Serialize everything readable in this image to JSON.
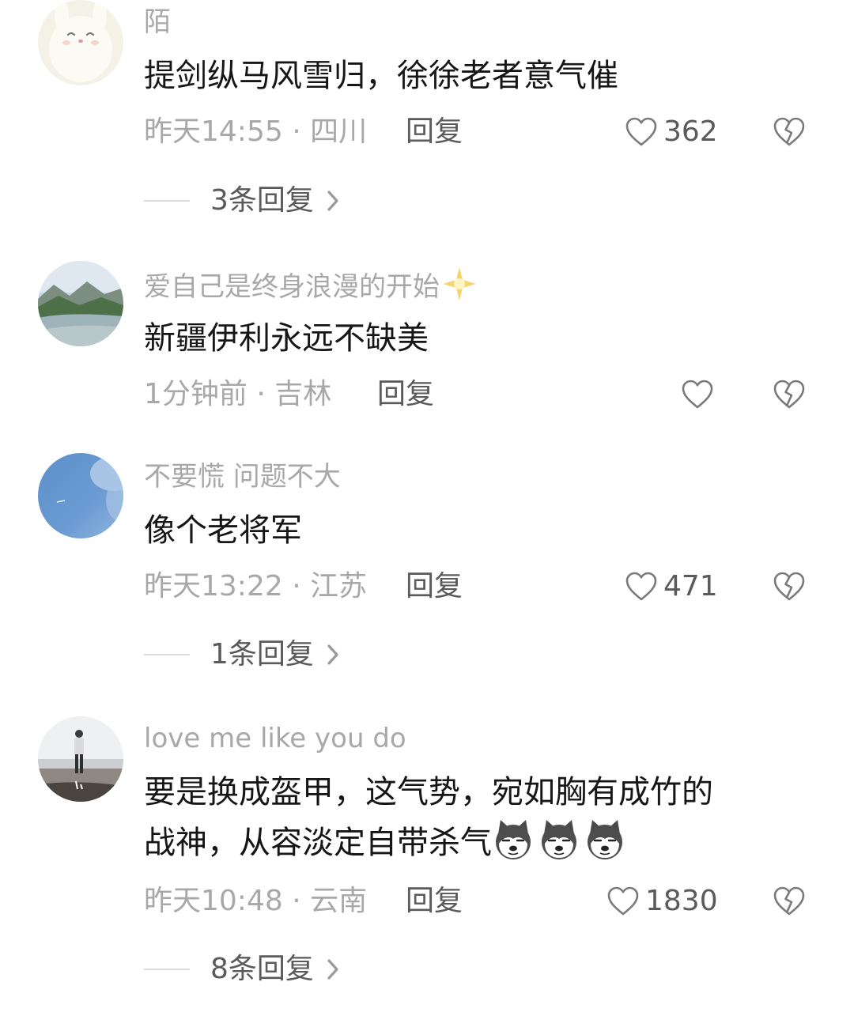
{
  "comments": [
    {
      "username": "陌",
      "text": "提剑纵马风雪归，徐徐老者意气催",
      "time_location": "昨天14:55 · 四川",
      "reply_label": "回复",
      "likes": "362",
      "replies_label": "3条回复"
    },
    {
      "username": "爱自己是终身浪漫的开始",
      "username_emoji": "sparkle-icon",
      "text": "新疆伊利永远不缺美",
      "time_location": "1分钟前 · 吉林",
      "reply_label": "回复",
      "likes": ""
    },
    {
      "username": "不要慌 问题不大",
      "text": "像个老将军",
      "time_location": "昨天13:22 · 江苏",
      "reply_label": "回复",
      "likes": "471",
      "replies_label": "1条回复"
    },
    {
      "username": "love me like you do",
      "text_line1": "要是换成盔甲，这气势，宛如胸有成竹的",
      "text_line2": "战神，从容淡定自带杀气",
      "text_emojis": [
        "husky-emoji",
        "husky-emoji",
        "husky-emoji"
      ],
      "time_location": "昨天10:48 · 云南",
      "reply_label": "回复",
      "likes": "1830",
      "replies_label": "8条回复"
    }
  ],
  "icons": {
    "like": "heart-outline-icon",
    "dislike": "broken-heart-icon",
    "expand": "chevron-right-icon"
  },
  "colors": {
    "text_primary": "#161616",
    "text_secondary": "#a8a8a8",
    "text_action": "#5a5a5a"
  }
}
